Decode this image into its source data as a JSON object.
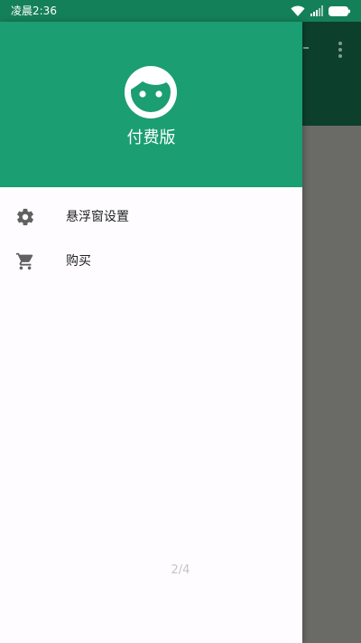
{
  "status_bar": {
    "time": "凌晨2:36"
  },
  "drawer": {
    "title": "付费版",
    "avatar_icon": "face-icon",
    "items": [
      {
        "label": "悬浮窗设置",
        "icon": "gear-icon"
      },
      {
        "label": "购买",
        "icon": "cart-icon"
      }
    ]
  },
  "page_indicator": "2/4",
  "colors": {
    "header_green": "#1a9e72",
    "status_green": "#14805a",
    "appbar_dark": "#0d3f2d",
    "scrim_gray": "#6a6a66"
  }
}
